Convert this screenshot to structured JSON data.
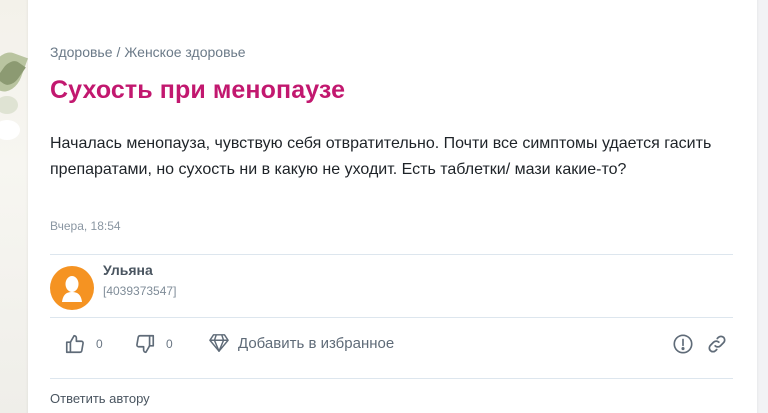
{
  "breadcrumb": {
    "section": "Здоровье",
    "separator": "/",
    "subsection": "Женское здоровье"
  },
  "post": {
    "title": "Сухость при менопаузе",
    "body": "Началась менопауза, чувствую себя отвратительно. Почти все симптомы удается гасить препаратами, но сухость ни в какую не уходит. Есть таблетки/ мази какие-то?",
    "timestamp": "Вчера, 18:54"
  },
  "author": {
    "name": "Ульяна",
    "id": "[4039373547]",
    "avatar_color": "#f59322"
  },
  "actions": {
    "likes": "0",
    "dislikes": "0",
    "favorite_label": "Добавить в избранное",
    "icons": [
      "thumbs-up-icon",
      "thumbs-down-icon",
      "diamond-icon",
      "report-icon",
      "link-icon"
    ]
  },
  "reply": {
    "label": "Ответить автору"
  },
  "colors": {
    "title": "#c2186f",
    "text": "#1e2328",
    "muted": "#8a96a2"
  }
}
